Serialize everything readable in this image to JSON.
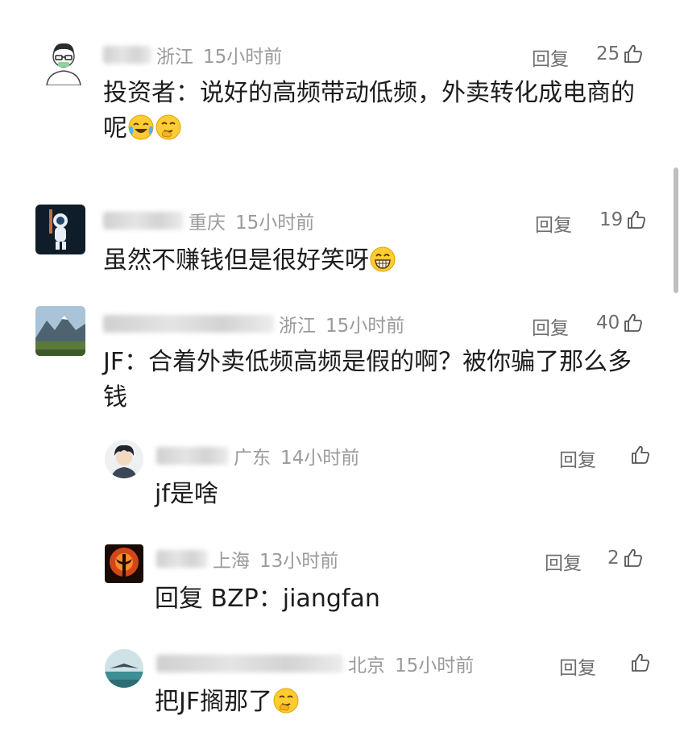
{
  "comments": [
    {
      "location": "浙江",
      "time": "15小时前",
      "reply_label": "回复",
      "like_count": "25",
      "text": "投资者：说好的高频带动低频，外卖转化成电商的呢",
      "emojis": [
        "crying-laughing-emoji",
        "thinking-hand-emoji"
      ]
    },
    {
      "location": "重庆",
      "time": "15小时前",
      "reply_label": "回复",
      "like_count": "19",
      "text": "虽然不赚钱但是很好笑呀",
      "emojis": [
        "grinning-emoji"
      ]
    },
    {
      "location": "浙江",
      "time": "15小时前",
      "reply_label": "回复",
      "like_count": "40",
      "text": "JF：合着外卖低频高频是假的啊？被你骗了那么多钱",
      "emojis": [],
      "replies": [
        {
          "location": "广东",
          "time": "14小时前",
          "reply_label": "回复",
          "like_count": "",
          "text": "jf是啥"
        },
        {
          "location": "上海",
          "time": "13小时前",
          "reply_label": "回复",
          "like_count": "2",
          "text": "回复 BZP：jiangfan"
        },
        {
          "location": "北京",
          "time": "15小时前",
          "reply_label": "回复",
          "like_count": "",
          "text": "把JF搁那了",
          "emojis": [
            "thinking-hand-emoji"
          ]
        }
      ]
    }
  ],
  "colors": {
    "text": "#1c1c1c",
    "meta": "#9a9a9a",
    "action": "#6e6e6e",
    "scrollbar": "#bfbfbf"
  }
}
